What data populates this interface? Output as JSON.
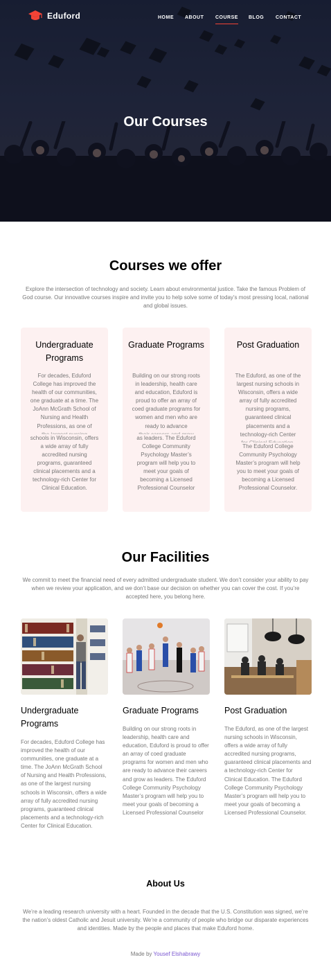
{
  "brand": {
    "name": "Eduford",
    "accent": "#f44336"
  },
  "nav": {
    "items": [
      {
        "label": "HOME",
        "active": false
      },
      {
        "label": "ABOUT",
        "active": false
      },
      {
        "label": "COURSE",
        "active": true
      },
      {
        "label": "BLOG",
        "active": false
      },
      {
        "label": "CONTACT",
        "active": false
      }
    ]
  },
  "hero": {
    "title": "Our Courses"
  },
  "courses": {
    "title": "Courses we offer",
    "intro": "Explore the intersection of technology and society. Learn about environmental justice. Take the famous Problem of God course. Our innovative courses inspire and invite you to help solve some of today’s most pressing local, national and global issues.",
    "cards": [
      {
        "title": "Undergraduate Programs",
        "text_top": "For decades, Eduford College has improved the health of our communities, one graduate at a time. The JoAnn McGrath School of Nursing and Health Professions, as one of",
        "text_clipped": "the largest nursing",
        "text_bottom": "schools in Wisconsin, offers a wide array of fully accredited nursing programs, guaranteed clinical placements and a technology-rich Center for Clinical Education."
      },
      {
        "title": "Graduate Programs",
        "text_top": "Building on our strong roots in leadership, health care and education, Eduford is proud to offer an array of coed graduate programs for women and men who are ready to advance",
        "text_clipped": "their careers and grow",
        "text_bottom": "as leaders. The Eduford College Community Psychology Master’s program will help you to meet your goals of becoming a Licensed Professional Counselor"
      },
      {
        "title": "Post Graduation",
        "text_top": "The Eduford, as one of the largest nursing schools in Wisconsin, offers a wide array of fully accredited nursing programs, guaranteed clinical placements and a technology-rich Center",
        "text_clipped": "for Clinical Education.",
        "text_bottom": "The Eduford College Community Psychology Master’s program will help you to meet your goals of becoming a Licensed Professional Counselor."
      }
    ]
  },
  "facilities": {
    "title": "Our Facilities",
    "intro": "We commit to meet the financial need of every admitted undergraduate student. We don’t consider your ability to pay when we review your application, and we don’t base our decision on whether you can cover the cost. If you’re accepted here, you belong here.",
    "items": [
      {
        "image": "library-photo",
        "title": "Undergraduate Programs",
        "text": "For decades, Eduford College has improved the health of our communities, one graduate at a time. The JoAnn McGrath School of Nursing and Health Professions, as one of the largest nursing schools in Wisconsin, offers a wide array of fully accredited nursing programs, guaranteed clinical placements and a technology-rich Center for Clinical Education."
      },
      {
        "image": "basketball-photo",
        "title": "Graduate Programs",
        "text": "Building on our strong roots in leadership, health care and education, Eduford is proud to offer an array of coed graduate programs for women and men who are ready to advance their careers and grow as leaders. The Eduford College Community Psychology Master’s program will help you to meet your goals of becoming a Licensed Professional Counselor"
      },
      {
        "image": "cafe-photo",
        "title": "Post Graduation",
        "text": "The Eduford, as one of the largest nursing schools in Wisconsin, offers a wide array of fully accredited nursing programs, guaranteed clinical placements and a technology-rich Center for Clinical Education. The Eduford College Community Psychology Master’s program will help you to meet your goals of becoming a Licensed Professional Counselor."
      }
    ]
  },
  "about": {
    "title": "About Us",
    "text": "We’re a leading research university with a heart. Founded in the decade that the U.S. Constitution was signed, we’re the nation’s oldest Catholic and Jesuit university. We’re a community of people who bridge our disparate experiences and identities. Made by the people and places that make Eduford home."
  },
  "footer": {
    "made_by": "Made by",
    "author": "Yousef Elshabrawy"
  }
}
